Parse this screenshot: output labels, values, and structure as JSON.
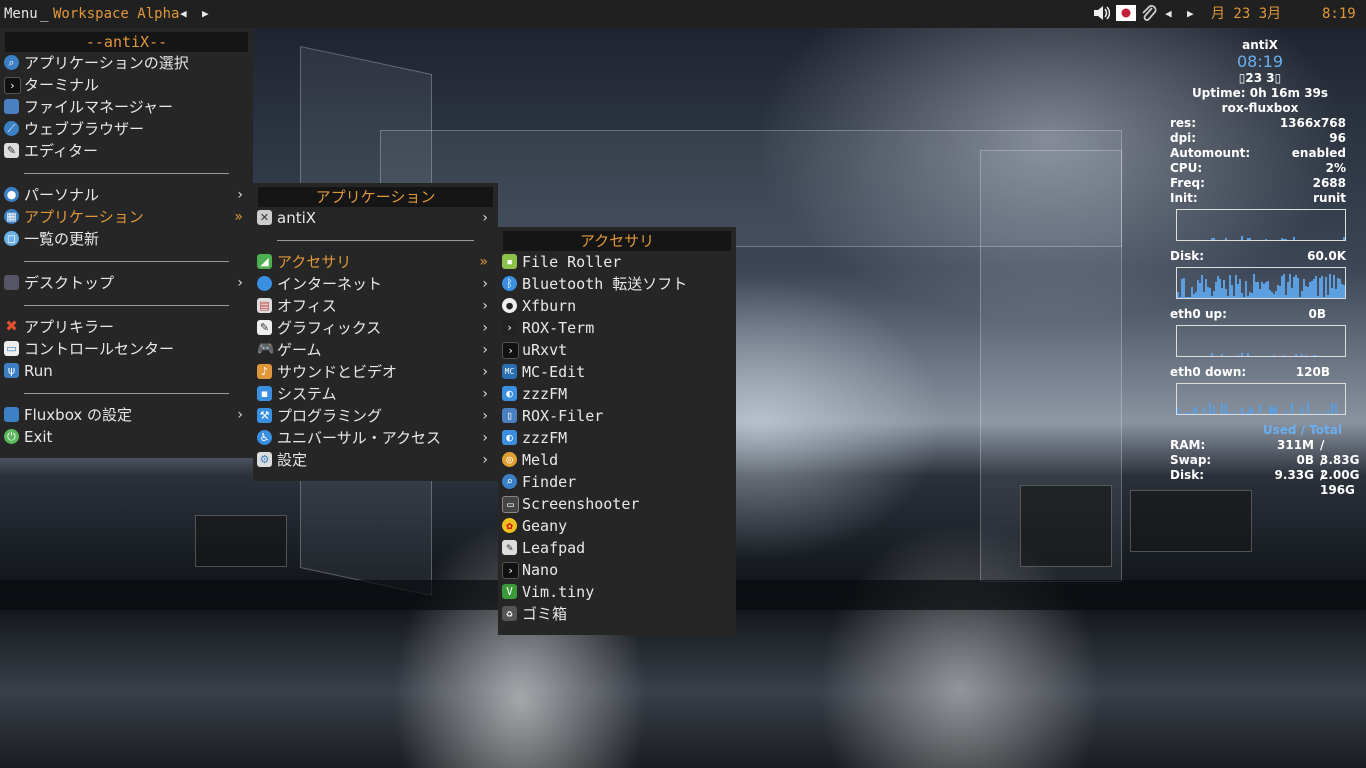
{
  "taskbar": {
    "menu_label": "Menu",
    "separator": "_",
    "workspace": "Workspace Alpha",
    "prev_arrow": "◀",
    "next_arrow": "▶",
    "volume_icon": "speaker-icon",
    "flag_icon": "japan-flag-icon",
    "network_icon": "paperclip-icon",
    "tray_prev": "◀",
    "tray_next": "▶",
    "date": "月 23  3月",
    "time": "8:19"
  },
  "root_menu": {
    "title": "--antiX--",
    "items": [
      {
        "label": "アプリケーションの選択",
        "icon": "search-icon"
      },
      {
        "label": "ターミナル",
        "icon": "terminal-icon"
      },
      {
        "label": "ファイルマネージャー",
        "icon": "folder-icon"
      },
      {
        "label": "ウェブブラウザー",
        "icon": "browser-icon"
      },
      {
        "label": "エディター",
        "icon": "editor-icon"
      },
      {
        "label": "パーソナル",
        "icon": "user-icon",
        "arrow": "›"
      },
      {
        "label": "アプリケーション",
        "icon": "apps-icon",
        "arrow": "»"
      },
      {
        "label": "一覧の更新",
        "icon": "refresh-icon"
      },
      {
        "label": "デスクトップ",
        "icon": "desktop-icon",
        "arrow": "›"
      },
      {
        "label": "アプリキラー",
        "icon": "kill-icon"
      },
      {
        "label": "コントロールセンター",
        "icon": "control-center-icon"
      },
      {
        "label": "Run",
        "icon": "run-icon"
      },
      {
        "label": "Fluxbox の設定",
        "icon": "fluxbox-icon",
        "arrow": "›"
      },
      {
        "label": "Exit",
        "icon": "power-icon"
      }
    ]
  },
  "apps_menu": {
    "title": "アプリケーション",
    "items": [
      {
        "label": "antiX",
        "icon": "antix-icon",
        "arrow": "›"
      },
      {
        "label": "アクセサリ",
        "icon": "accessories-icon",
        "arrow": "»"
      },
      {
        "label": "インターネット",
        "icon": "internet-icon",
        "arrow": "›"
      },
      {
        "label": "オフィス",
        "icon": "office-icon",
        "arrow": "›"
      },
      {
        "label": "グラフィックス",
        "icon": "graphics-icon",
        "arrow": "›"
      },
      {
        "label": "ゲーム",
        "icon": "gamepad-icon",
        "arrow": "›"
      },
      {
        "label": "サウンドとビデオ",
        "icon": "multimedia-icon",
        "arrow": "›"
      },
      {
        "label": "システム",
        "icon": "system-icon",
        "arrow": "›"
      },
      {
        "label": "プログラミング",
        "icon": "programming-icon",
        "arrow": "›"
      },
      {
        "label": "ユニバーサル・アクセス",
        "icon": "accessibility-icon",
        "arrow": "›"
      },
      {
        "label": "設定",
        "icon": "settings-icon",
        "arrow": "›"
      }
    ]
  },
  "accessories_menu": {
    "title": "アクセサリ",
    "items": [
      {
        "label": "File Roller",
        "icon": "archive-icon"
      },
      {
        "label": "Bluetooth 転送ソフト",
        "icon": "bluetooth-icon"
      },
      {
        "label": "Xfburn",
        "icon": "disc-burn-icon"
      },
      {
        "label": "ROX-Term",
        "icon": "terminal-icon"
      },
      {
        "label": "uRxvt",
        "icon": "terminal-icon"
      },
      {
        "label": "MC-Edit",
        "icon": "mc-edit-icon"
      },
      {
        "label": "zzzFM",
        "icon": "file-manager-icon"
      },
      {
        "label": "ROX-Filer",
        "icon": "rox-filer-icon"
      },
      {
        "label": "zzzFM",
        "icon": "file-manager-icon"
      },
      {
        "label": "Meld",
        "icon": "meld-icon"
      },
      {
        "label": "Finder",
        "icon": "search-icon"
      },
      {
        "label": "Screenshooter",
        "icon": "camera-icon"
      },
      {
        "label": "Geany",
        "icon": "geany-icon"
      },
      {
        "label": "Leafpad",
        "icon": "text-editor-icon"
      },
      {
        "label": "Nano",
        "icon": "terminal-icon"
      },
      {
        "label": "Vim.tiny",
        "icon": "vim-icon"
      },
      {
        "label": "ゴミ箱",
        "icon": "trash-icon"
      }
    ]
  },
  "conky": {
    "host": "antiX",
    "time": "08:19",
    "date": "▯23  3▯",
    "uptime": "Uptime: 0h 16m 39s",
    "session": "rox-fluxbox",
    "stats": [
      {
        "label": "res:",
        "value": "1366x768"
      },
      {
        "label": "dpi:",
        "value": "96"
      },
      {
        "label": "Automount:",
        "value": "enabled"
      },
      {
        "label": "CPU:",
        "value": "2%"
      },
      {
        "label": "Freq:",
        "value": "2688"
      },
      {
        "label": "Init:",
        "value": "runit"
      }
    ],
    "disk_label": "Disk:",
    "disk_value": "60.0K",
    "eth_up_label": "eth0 up:",
    "eth_up_value": "0B",
    "eth_down_label": "eth0 down:",
    "eth_down_value": "120B",
    "mem_header_used": "Used",
    "mem_header_sep": " / ",
    "mem_header_total": "Total",
    "mem": [
      {
        "label": "RAM:",
        "used": "311M",
        "total": "/ 3.83G"
      },
      {
        "label": "Swap:",
        "used": "0B",
        "total": "/ 2.00G"
      },
      {
        "label": "Disk:",
        "used": "9.33G",
        "total": "/ 196G"
      }
    ]
  },
  "colors": {
    "accent": "#e0973a",
    "menu_bg": "#262626",
    "title_bg": "#151515",
    "graph": "#5b9fe0",
    "mem_header": "#6ab0f0"
  }
}
